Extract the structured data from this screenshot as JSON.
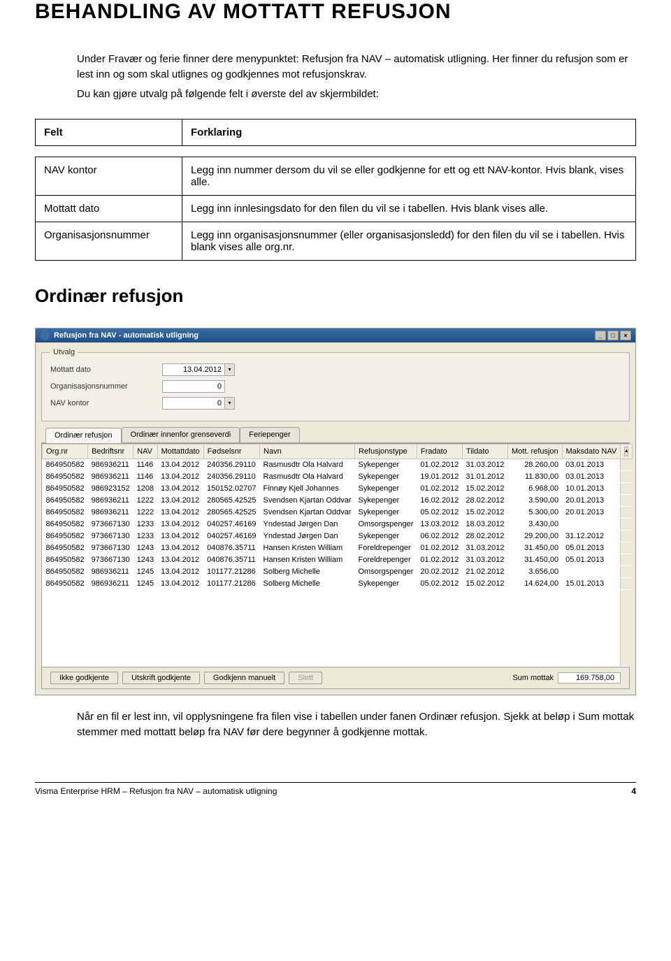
{
  "heading1": "BEHANDLING AV MOTTATT REFUSJON",
  "intro": {
    "p1": "Under Fravær og ferie finner dere menypunktet: Refusjon fra NAV – automatisk utligning. Her finner du refusjon som er lest inn og som skal utlignes og godkjennes mot refusjonskrav.",
    "p2": "Du kan gjøre utvalg på følgende felt i øverste del av skjermbildet:"
  },
  "defs": {
    "h_felt": "Felt",
    "h_forklaring": "Forklaring",
    "r1l": "NAV kontor",
    "r1r": "Legg inn nummer dersom du vil se eller godkjenne for ett og ett NAV-kontor. Hvis blank, vises alle.",
    "r2l": "Mottatt dato",
    "r2r": "Legg inn innlesingsdato for den filen du vil se i tabellen. Hvis blank vises alle.",
    "r3l": "Organisasjonsnummer",
    "r3r": "Legg inn organisasjonsnummer (eller organisasjonsledd) for den filen du vil se i tabellen. Hvis blank vises alle org.nr."
  },
  "heading2": "Ordinær refusjon",
  "app": {
    "title": "Refusjon fra NAV - automatisk utligning",
    "utvalg_legend": "Utvalg",
    "mottatt_label": "Mottatt dato",
    "mottatt_value": "13.04.2012",
    "org_label": "Organisasjonsnummer",
    "org_value": "0",
    "navk_label": "NAV kontor",
    "navk_value": "0",
    "tab1": "Ordinær refusjon",
    "tab2": "Ordinær innenfor grenseverdi",
    "tab3": "Feriepenger",
    "cols": [
      "Org.nr",
      "Bedriftsnr",
      "NAV",
      "Mottattdato",
      "Fødselsnr",
      "Navn",
      "Refusjonstype",
      "Fradato",
      "Tildato",
      "Mott. refusjon",
      "Maksdato NAV"
    ],
    "rows": [
      [
        "864950582",
        "986936211",
        "1146",
        "13.04.2012",
        "240356.29110",
        "Rasmusdtr Ola Halvard",
        "Sykepenger",
        "01.02.2012",
        "31.03.2012",
        "28.260,00",
        "03.01.2013"
      ],
      [
        "864950582",
        "986936211",
        "1146",
        "13.04.2012",
        "240356.29110",
        "Rasmusdtr Ola Halvard",
        "Sykepenger",
        "19.01.2012",
        "31.01.2012",
        "11.830,00",
        "03.01.2013"
      ],
      [
        "864950582",
        "986923152",
        "1208",
        "13.04.2012",
        "150152.02707",
        "Finnøy Kjell Johannes",
        "Sykepenger",
        "01.02.2012",
        "15.02.2012",
        "6.968,00",
        "10.01.2013"
      ],
      [
        "864950582",
        "986936211",
        "1222",
        "13.04.2012",
        "280565.42525",
        "Svendsen Kjartan Oddvar",
        "Sykepenger",
        "16.02.2012",
        "28.02.2012",
        "3.590,00",
        "20.01.2013"
      ],
      [
        "864950582",
        "986936211",
        "1222",
        "13.04.2012",
        "280565.42525",
        "Svendsen Kjartan Oddvar",
        "Sykepenger",
        "05.02.2012",
        "15.02.2012",
        "5.300,00",
        "20.01.2013"
      ],
      [
        "864950582",
        "973667130",
        "1233",
        "13.04.2012",
        "040257.46169",
        "Yndestad Jørgen Dan",
        "Omsorgspenger",
        "13.03.2012",
        "18.03.2012",
        "3.430,00",
        ""
      ],
      [
        "864950582",
        "973667130",
        "1233",
        "13.04.2012",
        "040257.46169",
        "Yndestad Jørgen Dan",
        "Sykepenger",
        "06.02.2012",
        "28.02.2012",
        "29.200,00",
        "31.12.2012"
      ],
      [
        "864950582",
        "973667130",
        "1243",
        "13.04.2012",
        "040876.35711",
        "Hansen Kristen William",
        "Foreldrepenger",
        "01.02.2012",
        "31.03.2012",
        "31.450,00",
        "05.01.2013"
      ],
      [
        "864950582",
        "973667130",
        "1243",
        "13.04.2012",
        "040876.35711",
        "Hansen Kristen William",
        "Foreldrepenger",
        "01.02.2012",
        "31.03.2012",
        "31.450,00",
        "05.01.2013"
      ],
      [
        "864950582",
        "986936211",
        "1245",
        "13.04.2012",
        "101177.21286",
        "Solberg Michelle",
        "Omsorgspenger",
        "20.02.2012",
        "21.02.2012",
        "3.656,00",
        ""
      ],
      [
        "864950582",
        "986936211",
        "1245",
        "13.04.2012",
        "101177.21286",
        "Solberg Michelle",
        "Sykepenger",
        "05.02.2012",
        "15.02.2012",
        "14.624,00",
        "15.01.2013"
      ]
    ],
    "btn_ikke": "Ikke godkjente",
    "btn_utskrift": "Utskrift godkjente",
    "btn_godkjenn": "Godkjenn manuelt",
    "btn_slett": "Slett",
    "sum_label": "Sum mottak",
    "sum_value": "169.758,00"
  },
  "below": "Når en fil er lest inn, vil opplysningene fra filen vise i tabellen under fanen Ordinær refusjon. Sjekk at beløp i Sum mottak stemmer med mottatt beløp fra NAV før dere begynner å godkjenne mottak.",
  "footer": {
    "left": "Visma Enterprise HRM – Refusjon fra NAV – automatisk utligning",
    "right": "4"
  }
}
